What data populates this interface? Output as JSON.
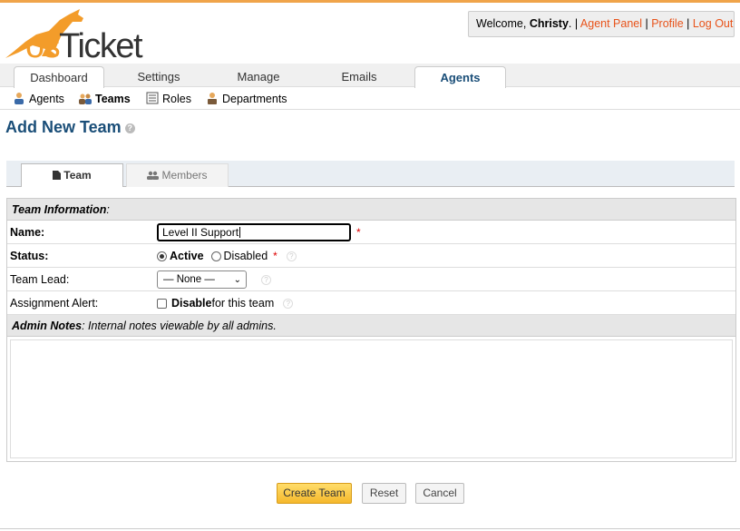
{
  "header": {
    "logo_text_os": "os",
    "logo_text_ticket": "Ticket",
    "welcome_prefix": "Welcome, ",
    "user_name": "Christy",
    "welcome_suffix": ".",
    "links": [
      "Agent Panel",
      "Profile",
      "Log Out"
    ],
    "separator": " | "
  },
  "nav": {
    "tabs": [
      "Dashboard",
      "Settings",
      "Manage",
      "Emails",
      "Agents"
    ],
    "active": "Agents"
  },
  "subnav": {
    "items": [
      "Agents",
      "Teams",
      "Roles",
      "Departments"
    ],
    "active": "Teams"
  },
  "page": {
    "title": "Add New Team",
    "help": "?"
  },
  "form_tabs": [
    "Team",
    "Members"
  ],
  "form": {
    "section_team_info": "Team Information",
    "section_team_info_suffix": ":",
    "name_label": "Name:",
    "name_value": "Level II Support",
    "required_mark": "*",
    "status_label": "Status:",
    "status_active": "Active",
    "status_disabled": "Disabled",
    "team_lead_label": "Team Lead:",
    "team_lead_value": "— None —",
    "assignment_alert_label": "Assignment Alert:",
    "disable_label": "Disable",
    "disable_suffix": " for this team",
    "admin_notes_label": "Admin Notes",
    "admin_notes_desc": ": Internal notes viewable by all admins."
  },
  "buttons": {
    "create": "Create Team",
    "reset": "Reset",
    "cancel": "Cancel"
  },
  "colors": {
    "accent_orange": "#e8531a",
    "title_blue": "#1a4e78",
    "primary_button": "#f5b82b"
  }
}
